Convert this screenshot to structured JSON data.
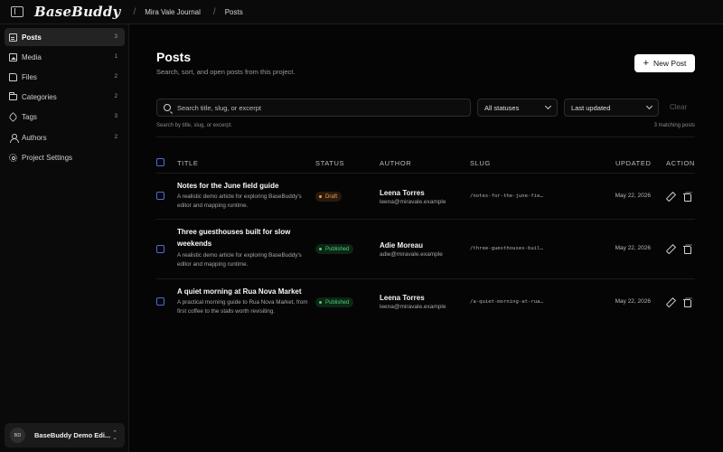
{
  "app": {
    "logo": "BaseBuddy"
  },
  "breadcrumb": {
    "project": "Mira Vale Journal",
    "page": "Posts",
    "separator": "/"
  },
  "sidebar": {
    "items": [
      {
        "label": "Posts",
        "count": "3",
        "icon": "document-icon",
        "active": true
      },
      {
        "label": "Media",
        "count": "1",
        "icon": "image-icon"
      },
      {
        "label": "Files",
        "count": "2",
        "icon": "file-icon"
      },
      {
        "label": "Categories",
        "count": "2",
        "icon": "folder-icon"
      },
      {
        "label": "Tags",
        "count": "3",
        "icon": "tag-icon"
      },
      {
        "label": "Authors",
        "count": "2",
        "icon": "user-icon"
      },
      {
        "label": "Project Settings",
        "count": "",
        "icon": "gear-icon"
      }
    ],
    "workspace": {
      "initials": "BD",
      "name": "BaseBuddy Demo Edi..."
    }
  },
  "main": {
    "title": "Posts",
    "subtitle": "Search, sort, and open posts from this project.",
    "new_post_label": "New Post",
    "search_placeholder": "Search title, slug, or excerpt",
    "status_filter": "All statuses",
    "sort_filter": "Last updated",
    "clear_label": "Clear",
    "search_help": "Search by title, slug, or excerpt.",
    "match_count": "3 matching posts"
  },
  "table": {
    "headers": {
      "title": "Title",
      "status": "Status",
      "author": "Author",
      "slug": "Slug",
      "updated": "Updated",
      "action": "Action"
    },
    "rows": [
      {
        "title": "Notes for the June field guide",
        "excerpt": "A realistic demo article for exploring BaseBuddy's editor and mapping runtime.",
        "status": "Draft",
        "author_name": "Leena Torres",
        "author_email": "leena@miravale.example",
        "slug": "/notes-for-the-june-fie…",
        "updated": "May 22, 2026"
      },
      {
        "title": "Three guesthouses built for slow weekends",
        "excerpt": "A realistic demo article for exploring BaseBuddy's editor and mapping runtime.",
        "status": "Published",
        "author_name": "Adie Moreau",
        "author_email": "adie@miravale.example",
        "slug": "/three-guesthouses-buil…",
        "updated": "May 22, 2026"
      },
      {
        "title": "A quiet morning at Rua Nova Market",
        "excerpt": "A practical morning guide to Rua Nova Market, from first coffee to the stalls worth revisiting.",
        "status": "Published",
        "author_name": "Leena Torres",
        "author_email": "leena@miravale.example",
        "slug": "/a-quiet-morning-at-rua…",
        "updated": "May 22, 2026"
      }
    ]
  },
  "colors": {
    "accent": "#4f6dd8",
    "draft": "#f0a04b",
    "published": "#4ad07a",
    "background": "#050505"
  }
}
